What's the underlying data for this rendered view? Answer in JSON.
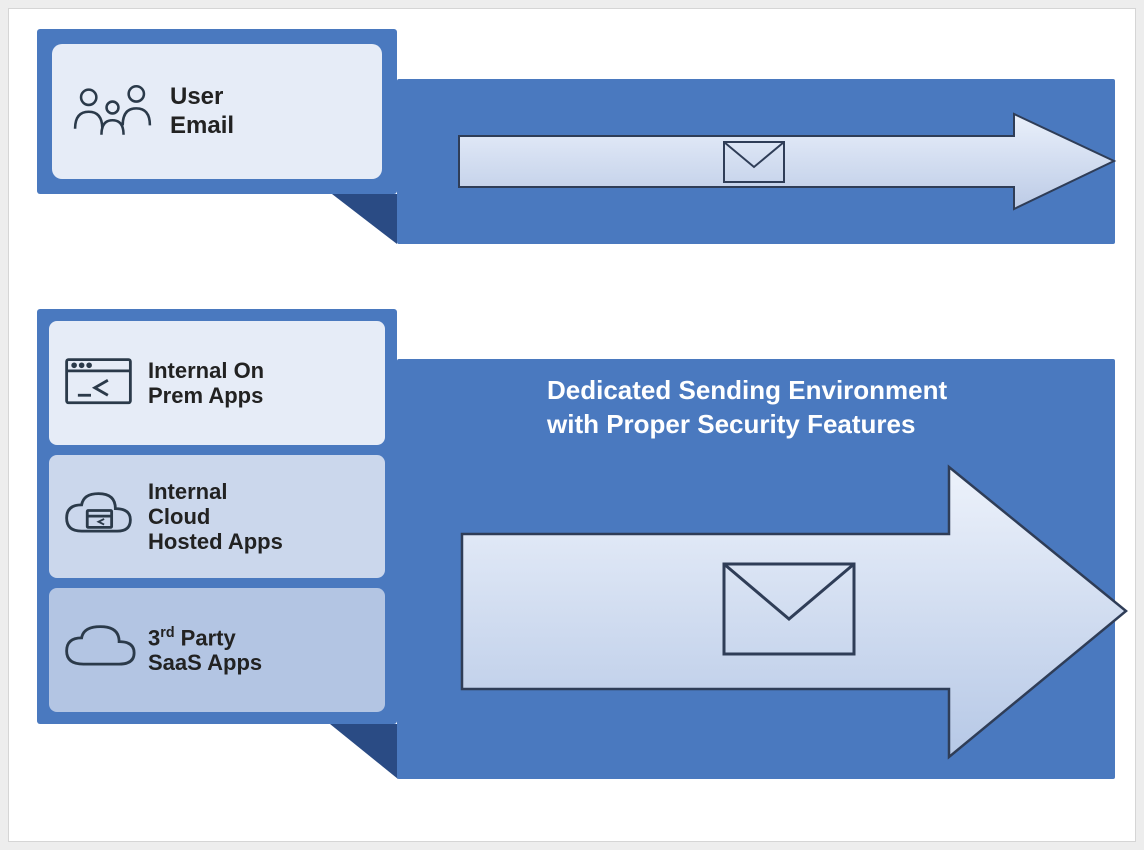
{
  "top": {
    "card_label_line1": "User",
    "card_label_line2": "Email"
  },
  "bottom": {
    "cards": [
      {
        "label_line1": "Internal On",
        "label_line2": "Prem Apps"
      },
      {
        "label_line1": "Internal",
        "label_line2": "Cloud",
        "label_line3": "Hosted Apps"
      },
      {
        "label_line1": "3",
        "label_sup": "rd",
        "label_line2": " Party",
        "label_line3": "SaaS Apps"
      }
    ],
    "right_title_line1": "Dedicated Sending Environment",
    "right_title_line2": "with Proper Security Features"
  }
}
